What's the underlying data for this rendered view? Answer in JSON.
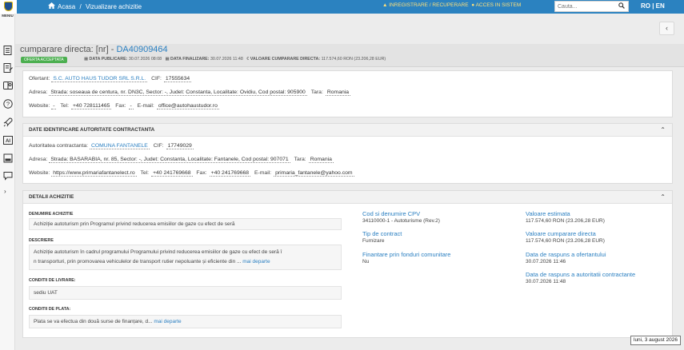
{
  "header": {
    "home_label": "Acasa",
    "breadcrumb_sep": "/",
    "breadcrumb_current": "Vizualizare achizitie",
    "register_link": "INREGISTRARE / RECUPERARE",
    "login_link": "ACCES IN SISTEM",
    "search_placeholder": "Cauta...",
    "lang": "RO | EN"
  },
  "sidebar": {
    "menu_label": "MENIU"
  },
  "purchase": {
    "title_prefix": "cumparare directa: [nr] - ",
    "code": "DA40909464",
    "status_badge": "OFERTA ACCEPTATA",
    "publish_label": "DATA PUBLICARE:",
    "publish_date": "30.07.2026 08:08",
    "finalize_label": "DATA FINALIZARE:",
    "finalize_date": "30.07.2026 11:48",
    "value_label": "VALOARE CUMPARARE DIRECTA:",
    "value": "117.574,60",
    "value_currency": "RON (23.206,28  EUR)"
  },
  "supplier": {
    "offerer_label": "Ofertant:",
    "offerer": "S.C. AUTO HAUS TUDOR SRL S.R.L.",
    "cif_label": "CIF:",
    "cif": "17555634",
    "address_label": "Adresa:",
    "address": "Strada: soseaua de centura, nr. DN3C, Sector: -, Judet: Constanta, Localitate: Ovidiu, Cod postal: 905900",
    "country_label": "Tara:",
    "country": "Romania",
    "website_label": "Website:",
    "website": "-",
    "tel_label": "Tel:",
    "tel": "+40 728111465",
    "fax_label": "Fax:",
    "fax": "-",
    "email_label": "E-mail:",
    "email": "office@autohaustudor.ro"
  },
  "authority": {
    "section_title": "DATE IDENTIFICARE AUTORITATE CONTRACTANTA",
    "name_label": "Autoritatea contractanta:",
    "name": "COMUNA FANTANELE",
    "cif_label": "CIF:",
    "cif": "17749029",
    "address_label": "Adresa:",
    "address": "Strada: BASARABIA, nr. 85, Sector: -, Judet: Constanta, Localitate: Fantanele, Cod postal: 907071",
    "country_label": "Tara:",
    "country": "Romania",
    "website_label": "Website:",
    "website": "https://www.primariafantanelect.ro",
    "tel_label": "Tel:",
    "tel": "+40 241769668",
    "fax_label": "Fax:",
    "fax": "+40 241769668",
    "email_label": "E-mail:",
    "email": "primaria_fantanele@yahoo.com"
  },
  "details": {
    "section_title": "DETALII ACHIZITIE",
    "name_label": "DENUMIRE ACHIZITIE",
    "name": "Achiziție autoturism prin Programul privind reducerea emisiilor de gaze cu efect de seră",
    "description_label": "DESCRIERE",
    "description_line1": "Achiziție autoturism în cadrul programului Programului privind reducerea emisiilor de gaze cu efect de seră î",
    "description_line2": "n transporturi, prin promovarea vehiculelor de transport rutier nepoluante și eficiente din ...",
    "more_label": "mai departe",
    "delivery_label": "CONDITII DE LIVRARE:",
    "delivery": "sediu UAT",
    "payment_label": "CONDITII DE PLATA:",
    "payment": "Plata se va efectua din două surse de finanțare, d...",
    "cpv_label": "Cod si denumire CPV",
    "cpv": "34110000-1 - Autoturisme (Rev.2)",
    "contract_type_label": "Tip de contract",
    "contract_type": "Furnizare",
    "eu_funds_label": "Finantare prin fonduri comunitare",
    "eu_funds": "Nu",
    "estimated_label": "Valoare estimata",
    "estimated": "117.574,60  RON (23.206,28  EUR)",
    "purchase_value_label": "Valoare cumparare directa",
    "purchase_value": "117.574,60  RON (23.206,28  EUR)",
    "offer_response_label": "Data de raspuns a ofertantului",
    "offer_response": "30.07.2026 11:46",
    "authority_response_label": "Data de raspuns a autoritatii contractante",
    "authority_response": "30.07.2026 11:48"
  },
  "tooltip": "luni, 3 august 2026"
}
